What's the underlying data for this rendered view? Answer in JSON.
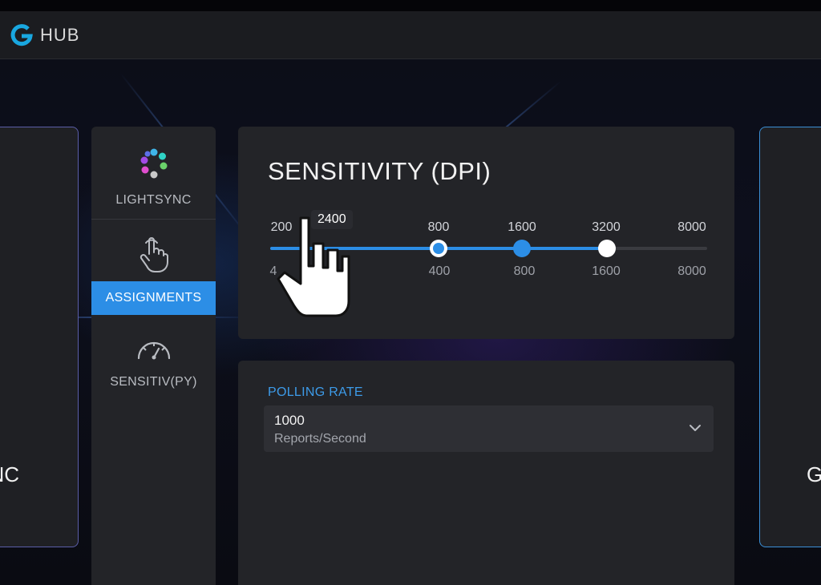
{
  "app": {
    "title": "HUB",
    "accent": "#2c8ee6",
    "logo_color": "#19a7e0"
  },
  "cards": {
    "left_caption": "NC",
    "right_caption": "G"
  },
  "nav": {
    "items": [
      {
        "label": "LIGHTSYNC",
        "icon": "lightsync-dots-icon",
        "active": false
      },
      {
        "label": "ASSIGNMENTS",
        "icon": "hand-pointer-icon",
        "active": true
      },
      {
        "label": "SENSITIV(PY)",
        "icon": "speedometer-icon",
        "active": false
      }
    ]
  },
  "dpi": {
    "title": "SENSITIVITY (DPI)",
    "top_labels": [
      "200",
      "800",
      "1600",
      "3200",
      "8000"
    ],
    "bottom_labels": [
      "4",
      "400",
      "800",
      "1600",
      "8000"
    ],
    "tooltip": "2400",
    "fill_fraction": 0.77
  },
  "polling": {
    "title": "POLLING RATE",
    "value": "1000",
    "unit": "Reports/Second"
  }
}
